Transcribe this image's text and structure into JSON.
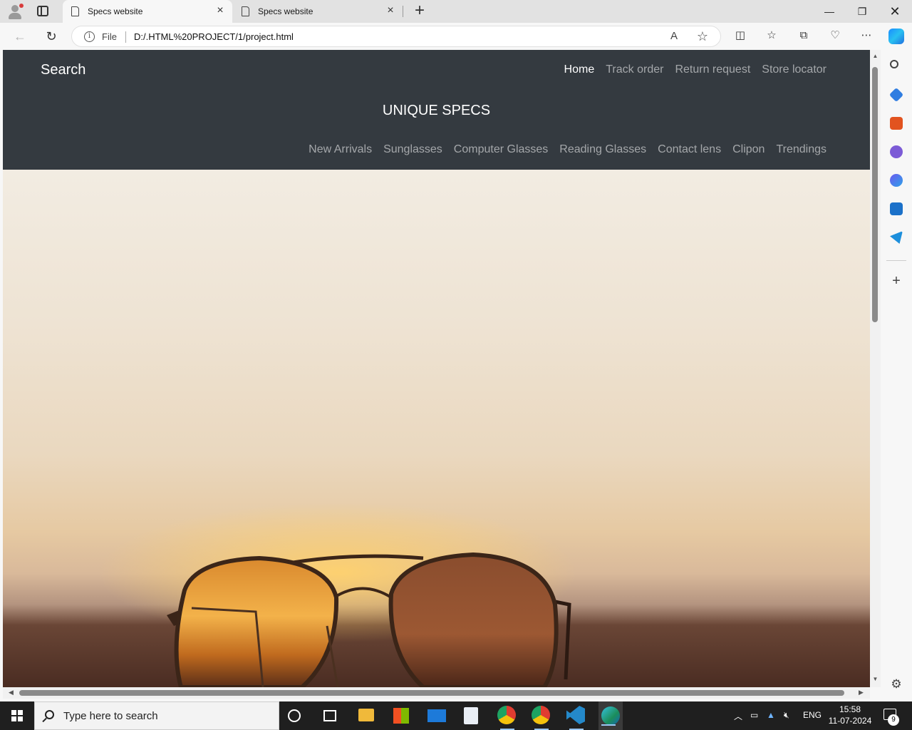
{
  "browser": {
    "tabs": [
      {
        "title": "Specs website",
        "active": true
      },
      {
        "title": "Specs website",
        "active": false
      }
    ],
    "address": {
      "scheme_label": "File",
      "url": "D:/.HTML%20PROJECT/1/project.html"
    }
  },
  "site": {
    "search_label": "Search",
    "brand": "UNIQUE SPECS",
    "top_nav": [
      {
        "label": "Home",
        "active": true
      },
      {
        "label": "Track order",
        "active": false
      },
      {
        "label": "Return request",
        "active": false
      },
      {
        "label": "Store locator",
        "active": false
      }
    ],
    "category_nav": [
      "New Arrivals",
      "Sunglasses",
      "Computer Glasses",
      "Reading Glasses",
      "Contact lens",
      "Clipon",
      "Trendings"
    ],
    "header_color": "#343a40"
  },
  "taskbar": {
    "search_placeholder": "Type here to search",
    "language": "ENG",
    "time": "15:58",
    "date": "11-07-2024",
    "notification_count": "9"
  },
  "icons": [
    "profile-icon",
    "tab-actions-icon",
    "page-icon",
    "close-icon",
    "new-tab-icon",
    "minimize-icon",
    "restore-icon",
    "back-icon",
    "refresh-icon",
    "info-icon",
    "read-aloud-icon",
    "favorite-star-icon",
    "split-screen-icon",
    "favorites-icon",
    "collections-icon",
    "browser-essentials-icon",
    "more-icon",
    "copilot-icon",
    "sidebar-search-icon",
    "shopping-icon",
    "tools-icon",
    "games-icon",
    "m365-icon",
    "outlook-icon",
    "telegram-icon",
    "add-icon",
    "settings-icon",
    "windows-start-icon",
    "search-icon",
    "cortana-icon",
    "task-view-icon",
    "file-explorer-icon",
    "store-icon",
    "mail-icon",
    "notepad-icon",
    "chrome-icon",
    "vscode-icon",
    "edge-icon",
    "chevron-up-icon",
    "network-icon",
    "onedrive-icon",
    "volume-muted-icon",
    "notification-icon"
  ]
}
